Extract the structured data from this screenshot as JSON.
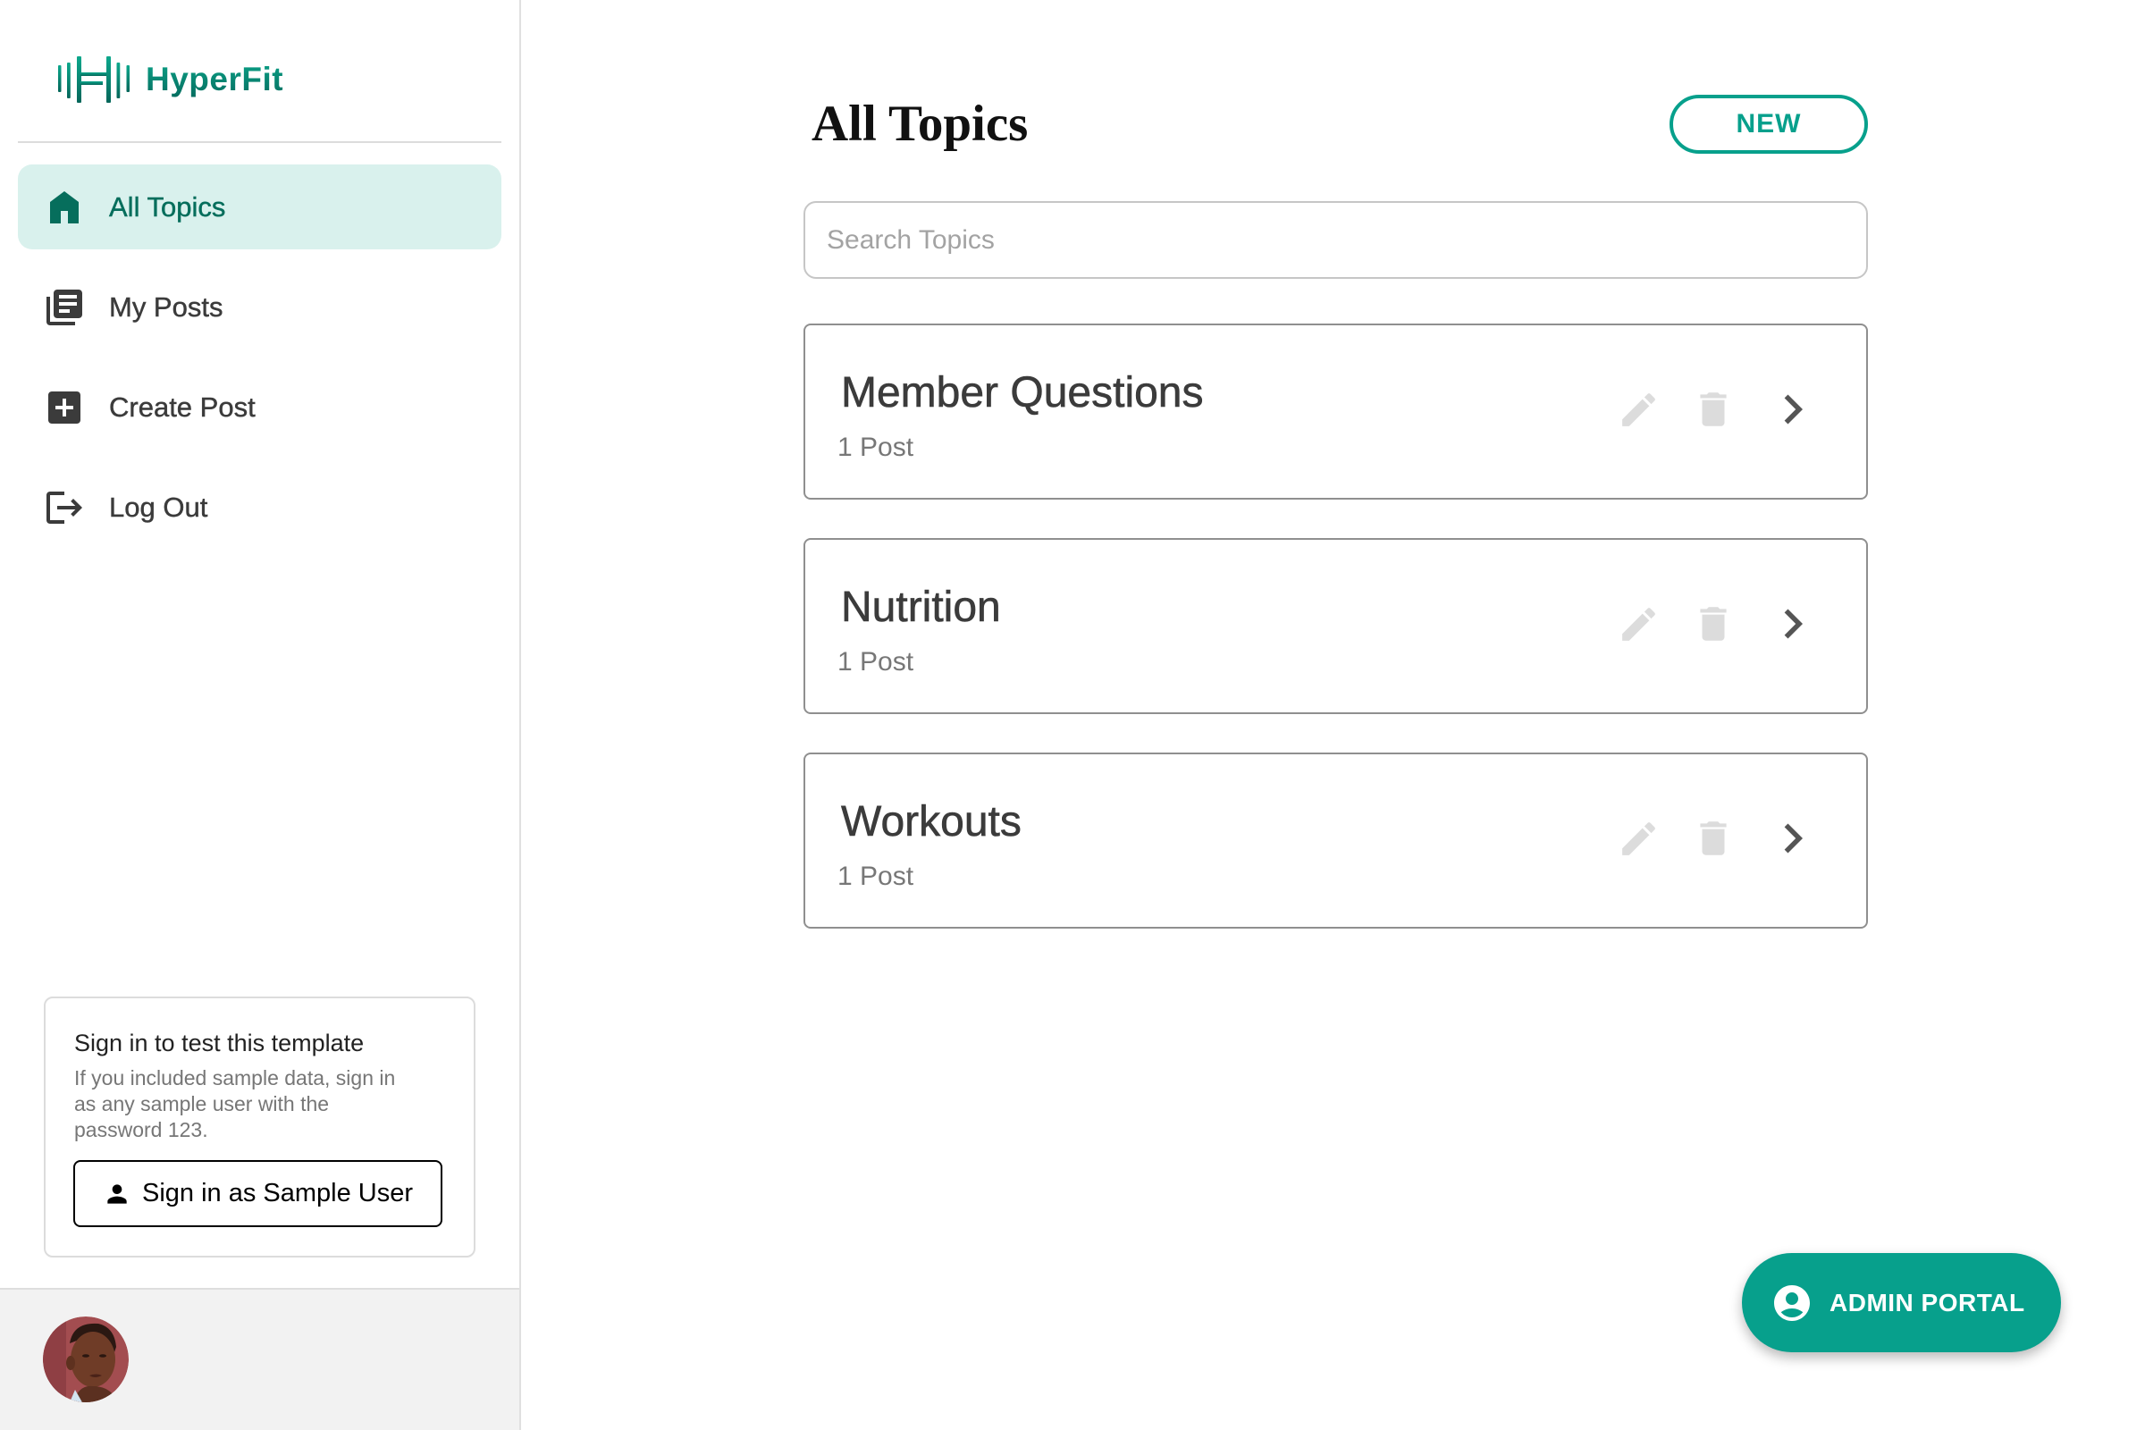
{
  "app": {
    "name": "HyperFit",
    "logo_icon": "barbell-icon"
  },
  "sidebar": {
    "nav": [
      {
        "label": "All Topics",
        "icon": "home-icon",
        "active": true
      },
      {
        "label": "My Posts",
        "icon": "library-books-icon",
        "active": false
      },
      {
        "label": "Create Post",
        "icon": "add-box-icon",
        "active": false
      },
      {
        "label": "Log Out",
        "icon": "logout-icon",
        "active": false
      }
    ],
    "signin_card": {
      "title": "Sign in to test this template",
      "body": "If you included sample data, sign in as any sample user with the password 123.",
      "button_label": "Sign in as Sample User",
      "button_icon": "person-icon"
    },
    "footer": {
      "avatar": "user-avatar"
    }
  },
  "main": {
    "title": "All Topics",
    "new_button_label": "NEW",
    "search": {
      "placeholder": "Search Topics",
      "value": ""
    },
    "topics": [
      {
        "name": "Member Questions",
        "count_label": "1 Post"
      },
      {
        "name": "Nutrition",
        "count_label": "1 Post"
      },
      {
        "name": "Workouts",
        "count_label": "1 Post"
      }
    ],
    "topic_actions": [
      "edit-icon",
      "delete-icon",
      "chevron-right-icon"
    ]
  },
  "fab": {
    "label": "ADMIN PORTAL",
    "icon": "account-circle-icon"
  },
  "colors": {
    "brand": "#07a08c",
    "brand_dark": "#066e5c",
    "active_bg": "#d9f1ed",
    "text": "#3b3b3b",
    "muted": "#777777",
    "icon_disabled": "#dcdcdc"
  }
}
